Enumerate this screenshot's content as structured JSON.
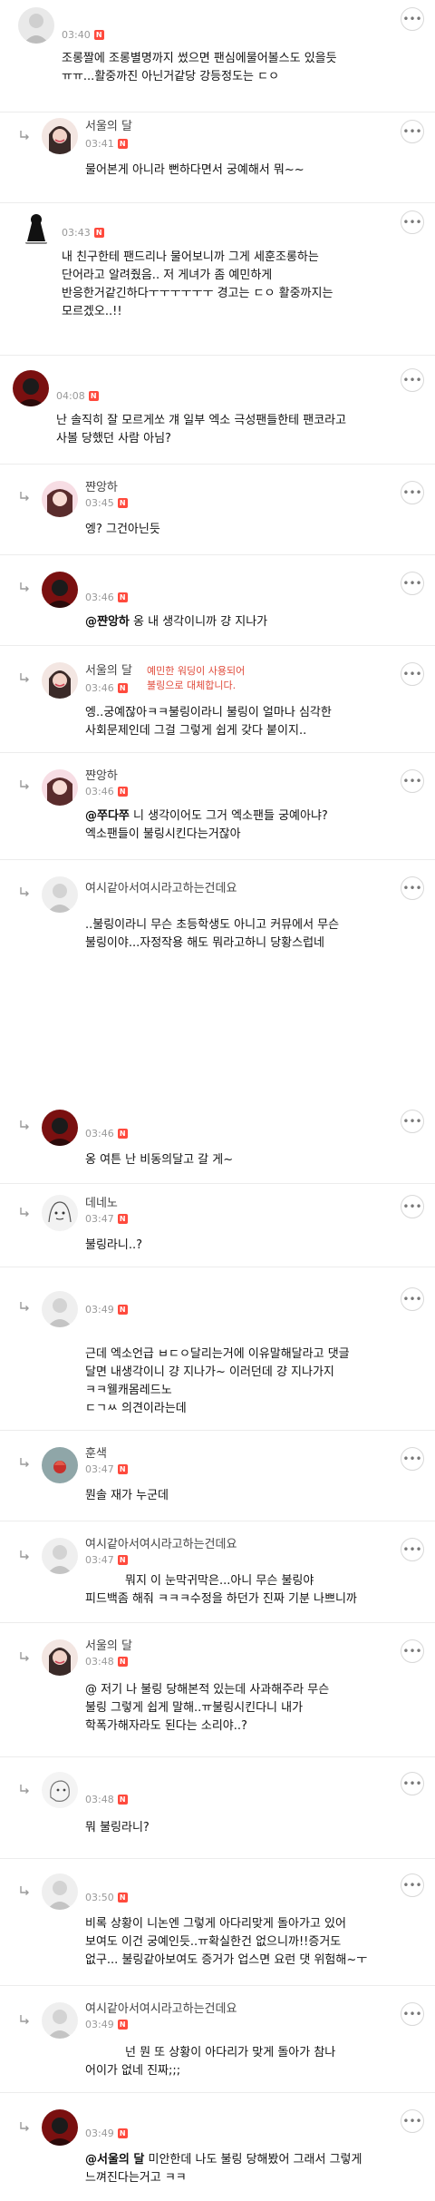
{
  "new_badge": "N",
  "comments": [
    {
      "name": "",
      "time": "03:40",
      "lines": [
        "조롱짤에 조롱별명까지 썼으면 팬심에물어볼스도 있을듯",
        "ㅠㅠ...활중까진 아닌거같당 강등정도는 ㄷㅇ"
      ]
    },
    {
      "name": "서울의 달",
      "time": "03:41",
      "lines": [
        "물어본게 아니라 뻔하다면서 궁예해서 뭐~~"
      ]
    },
    {
      "name": "",
      "time": "03:43",
      "lines": [
        "내 친구한테 팬드리나 물어보니까 그게 세훈조롱하는",
        "단어라고 알려줬음.. 저 게녀가 좀 예민하게",
        "반응한거같긴하다ㅜㅜㅜㅜㅜㅜ 경고는 ㄷㅇ 활중까지는",
        "모르겠오..!!"
      ]
    },
    {
      "name": "",
      "time": "04:08",
      "lines": [
        "난 솔직히 잘 모르게쏘 걔 일부 엑소 극성팬들한테 팬코라고",
        "사볼 당했던 사람 아님?"
      ]
    },
    {
      "name": "쨘앙하",
      "time": "03:45",
      "lines": [
        "엥? 그건아닌듯"
      ]
    },
    {
      "name": "",
      "time": "03:46",
      "mention": "@쨘앙하",
      "lines": [
        " 옹 내 생각이니까 걍 지나가"
      ]
    },
    {
      "name": "서울의 달",
      "time": "03:46",
      "warning": [
        "예민한 워딩이 사용되어",
        "불링으로 대체합니다."
      ],
      "lines": [
        "엥..궁예잖아ㅋㅋ불링이라니 불링이 얼마나 심각한",
        "사회문제인데 그걸 그렇게 쉽게 갖다 붙이지.."
      ]
    },
    {
      "name": "쨘앙하",
      "time": "03:46",
      "mention": "@쭈다쭈",
      "lines": [
        " 니 생각이어도 그거 엑소팬들 궁예아냐?",
        "엑소팬들이 불링시킨다는거잖아"
      ]
    },
    {
      "name": "여시같아서여시라고하는건데요",
      "time": "03:46",
      "lines": [
        "..불링이라니 무슨 초등학생도 아니고 커뮤에서 무슨",
        "불링이야...자정작용 해도 뭐라고하니 당황스럽네"
      ]
    },
    {
      "name": "",
      "time": "03:46",
      "lines": [
        "옹 여튼 난 비동의달고 갈 게~"
      ]
    },
    {
      "name": "데네노",
      "time": "03:47",
      "lines": [
        "불링라니..?"
      ]
    },
    {
      "name": "",
      "time": "03:49",
      "lines": [
        "근데 엑소언급 ㅂㄷㅇ달리는거에 이유말해달라고 댓글",
        "달면 내생각이니 걍 지나가~ 이러던데 걍 지나가지",
        "ㅋㅋ웰캐몸레드노",
        "ㄷㄱㅆ 의견이라는데"
      ]
    },
    {
      "name": "훈색",
      "time": "03:47",
      "lines": [
        "뭔솔 재가 누군데"
      ]
    },
    {
      "name": "여시같아서여시라고하는건데요",
      "time": "03:47",
      "lines": [
        "뭐지 이 눈막귀막은...아니 무슨 불링야",
        "피드백좀 해줘 ㅋㅋㅋ수정을 하던가 진짜 기분 나쁘니까"
      ]
    },
    {
      "name": "서울의 달",
      "time": "03:48",
      "lines": [
        "@        저기 나 불링 당해본적 있는데 사과해주라 무슨",
        "불링   그렇게 쉽게 말해..ㅠ불링시킨다니 내가",
        "학폭가해자라도 된다는 소리야..?"
      ]
    },
    {
      "name": "",
      "time": "03:48",
      "lines": [
        "뭐 불링라니?"
      ]
    },
    {
      "name": "",
      "time": "03:50",
      "lines": [
        "비록 상황이 니논엔 그렇게 아다리맞게 돌아가고 있어",
        "보여도 이건 궁예인듯..ㅠ확실한건 없으니까!!증거도",
        "없구... 불링같아보여도 증거가 업스면 요런 댓 위험해~ㅜ"
      ]
    },
    {
      "name": "여시같아서여시라고하는건데요",
      "time": "03:49",
      "lines": [
        "넌 뭔 또 상황이 아다리가 맞게 돌아가 참나",
        "어이가 없네 진짜;;;"
      ]
    },
    {
      "name": "",
      "time": "03:49",
      "mention": "@서울의 달",
      "lines": [
        " 미안한데 나도 불링 당해봤어 그래서 그렇게",
        "느껴진다는거고 ㅋㅋ"
      ]
    }
  ]
}
